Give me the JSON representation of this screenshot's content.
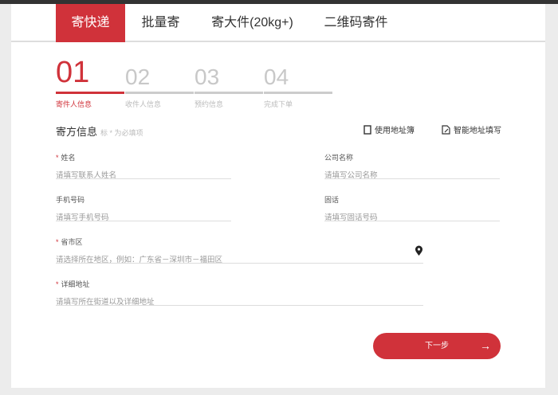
{
  "tabs": [
    "寄快递",
    "批量寄",
    "寄大件(20kg+)",
    "二维码寄件"
  ],
  "steps": [
    {
      "num": "01",
      "label": "寄件人信息"
    },
    {
      "num": "02",
      "label": "收件人信息"
    },
    {
      "num": "03",
      "label": "预约信息"
    },
    {
      "num": "04",
      "label": "完成下单"
    }
  ],
  "section": {
    "title": "寄方信息",
    "hint": "标 * 为必填项"
  },
  "actions": {
    "address_book": "使用地址簿",
    "smart_fill": "智能地址填写"
  },
  "fields": {
    "name": {
      "label": "姓名",
      "placeholder": "请填写联系人姓名",
      "required": "*"
    },
    "company": {
      "label": "公司名称",
      "placeholder": "请填写公司名称"
    },
    "mobile": {
      "label": "手机号码",
      "placeholder": "请填写手机号码"
    },
    "phone": {
      "label": "固话",
      "placeholder": "请填写固话号码"
    },
    "region": {
      "label": "省市区",
      "placeholder": "请选择所在地区，例如：广东省－深圳市－福田区",
      "required": "*"
    },
    "address": {
      "label": "详细地址",
      "placeholder": "请填写所在街道以及详细地址",
      "required": "*"
    }
  },
  "next_label": "下一步",
  "accent": "#d0323a"
}
